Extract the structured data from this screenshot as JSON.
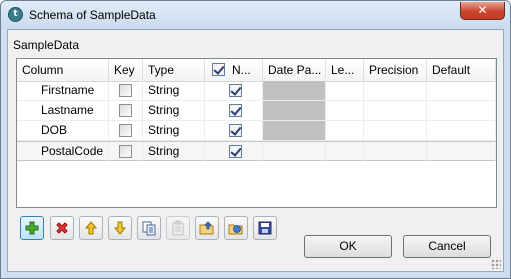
{
  "window": {
    "title": "Schema of SampleData",
    "app_icon_glyph": "t",
    "close_glyph": "✕"
  },
  "group": {
    "label": "SampleData"
  },
  "table": {
    "columns": [
      "Column",
      "Key",
      "Type",
      "N...",
      "Date Pa...",
      "Le...",
      "Precision",
      "Default"
    ],
    "nullable_header_checked": true,
    "rows": [
      {
        "column": "Firstname",
        "key": false,
        "type": "String",
        "nullable": true,
        "date_pattern": "",
        "length": "",
        "precision": "",
        "default": ""
      },
      {
        "column": "Lastname",
        "key": false,
        "type": "String",
        "nullable": true,
        "date_pattern": "",
        "length": "",
        "precision": "",
        "default": ""
      },
      {
        "column": "DOB",
        "key": false,
        "type": "String",
        "nullable": true,
        "date_pattern": "",
        "length": "",
        "precision": "",
        "default": ""
      },
      {
        "column": "PostalCode",
        "key": false,
        "type": "String",
        "nullable": true,
        "date_pattern": "",
        "length": "",
        "precision": "",
        "default": ""
      }
    ]
  },
  "toolbar": {
    "buttons": [
      {
        "name": "add-icon",
        "color": "#3a9a2a"
      },
      {
        "name": "remove-icon",
        "color": "#d02020"
      },
      {
        "name": "move-up-icon",
        "color": "#e8b400"
      },
      {
        "name": "move-down-icon",
        "color": "#e8b400"
      },
      {
        "name": "copy-icon",
        "color": "#4a6a9a"
      },
      {
        "name": "paste-icon",
        "color": "#9a9a9a"
      },
      {
        "name": "import-icon",
        "color": "#2a6ac0"
      },
      {
        "name": "export-icon",
        "color": "#2a6ac0"
      },
      {
        "name": "save-icon",
        "color": "#2a3a9a"
      }
    ]
  },
  "buttons": {
    "ok_label": "OK",
    "cancel_label": "Cancel"
  }
}
